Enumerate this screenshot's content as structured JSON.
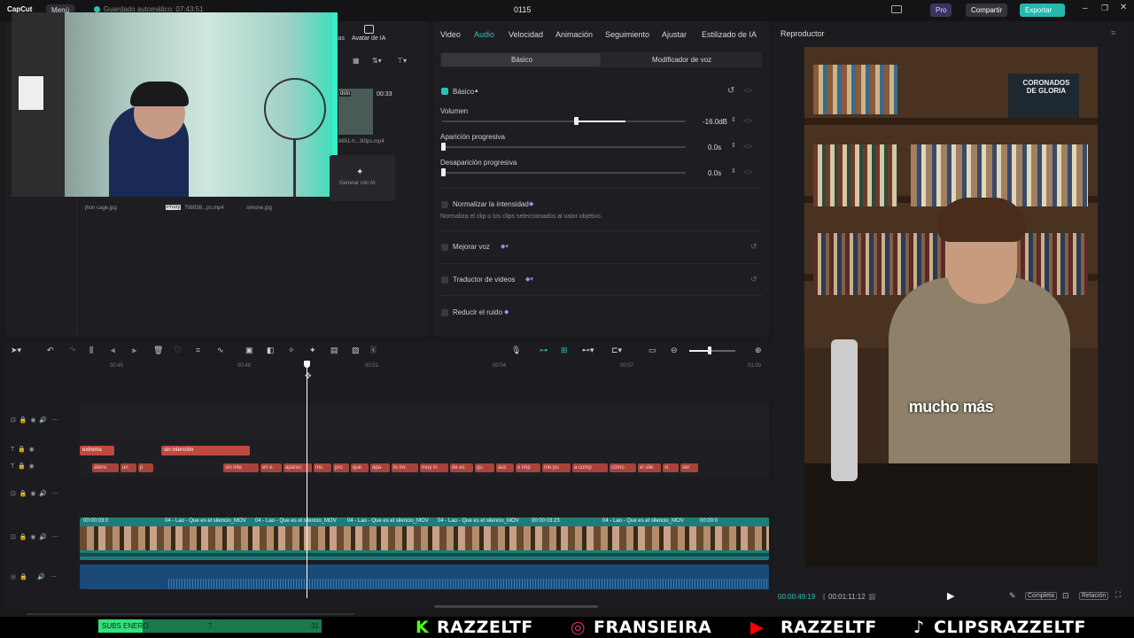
{
  "titlebar": {
    "app": "CapCut",
    "menu": "Menú",
    "autosave": "Guardado automático: 07:43:51",
    "project": "0115",
    "pro": "Pro",
    "share": "Compartir",
    "export": "Exportar"
  },
  "media": {
    "ia_tab": "Avatar de IA",
    "tab_partial": "las",
    "duration": "00:33",
    "file1": "8851-h...30fps.mp4",
    "generate": "Generar con IA",
    "labels": [
      "jhon cage.jpg",
      "798938...ps.mp4",
      "simone.jpg"
    ],
    "proxy": "Proxy",
    "badge": "dido"
  },
  "props": {
    "tabs": [
      "Video",
      "Audio",
      "Velocidad",
      "Animación",
      "Seguimiento",
      "Ajustar",
      "Estilizado de IA"
    ],
    "active_tab": "Audio",
    "sub": [
      "Básico",
      "Modificador de voz"
    ],
    "basic": "Básico",
    "volume_label": "Volumen",
    "volume_value": "-16.0dB",
    "fadein_label": "Aparición progresiva",
    "fadein_value": "0.0s",
    "fadeout_label": "Desaparición progresiva",
    "fadeout_value": "0.0s",
    "normalize": "Normalizar la intensidad",
    "normalize_desc": "Normaliza el clip o los clips seleccionados al valor objetivo.",
    "improve": "Mejorar voz",
    "translate": "Traductor de videos",
    "noise": "Reducir el ruido"
  },
  "player": {
    "title": "Reproductor",
    "caption": "mucho más",
    "time_current": "00:00:49:19",
    "time_total": "00:01:11:12",
    "complete": "Completa",
    "ratio": "Relación",
    "book_title": "CORONADOS DE GLORIA"
  },
  "timeline": {
    "ticks": [
      "00:45",
      "00:48",
      "00:51",
      "00:54",
      "00:57",
      "01:00"
    ],
    "text_clips_1": [
      "extrema",
      "sin intención"
    ],
    "text_clips_2": [
      "atenc",
      "un",
      "p",
      "sin inte",
      "en e",
      "aparec",
      "mu",
      "pro",
      "que",
      "apa",
      "lo inv",
      "muy in",
      "de es",
      "qu",
      "auc",
      "e imp",
      "me pu",
      "a comp",
      "cómo",
      "el sile",
      "si",
      "ser"
    ],
    "video_labels": [
      "00:00:03:0",
      "04 - Lao - Que es el silencio_MOV",
      "04 - Lao - Que es el silencio_MOV",
      "04 - Lao - Que es el silencio_MOV",
      "04 - Lao - Que es el silencio_MOV",
      "00:00:03:23",
      "04 - Lao - Que es el silencio_MOV",
      "00:00:0"
    ]
  },
  "bottom": {
    "subs": "SUBS ENERO",
    "sub_mid": "7",
    "sub_end": "31",
    "sub_progress": 0.2,
    "handles": [
      "RAZZELTF",
      "FRANSIEIRA",
      "RAZZELTF",
      "CLIPSRAZZELTF"
    ]
  },
  "colors": {
    "accent": "#2fc0b5",
    "clip_red": "#c0483f",
    "video_teal": "#1d7d78",
    "audio_blue": "#1a4a78"
  }
}
